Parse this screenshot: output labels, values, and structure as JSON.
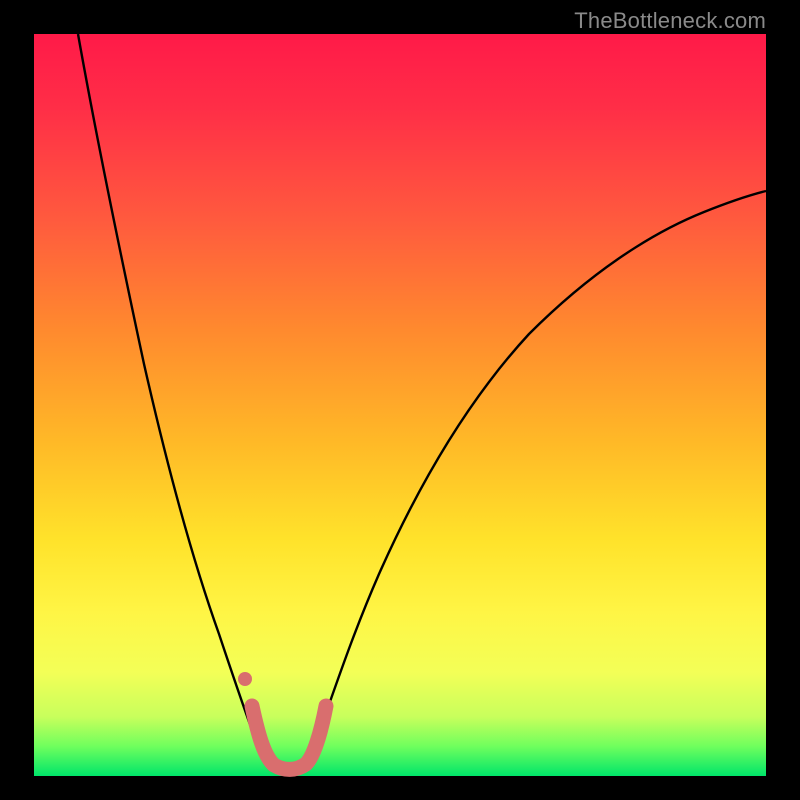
{
  "watermark": "TheBottleneck.com",
  "chart_data": {
    "type": "line",
    "title": "",
    "xlabel": "",
    "ylabel": "",
    "ylim": [
      0,
      100
    ],
    "series": [
      {
        "name": "black-curve-left",
        "x": [
          0.06,
          0.1,
          0.14,
          0.18,
          0.22,
          0.26,
          0.28,
          0.3,
          0.31
        ],
        "values": [
          100,
          88,
          73,
          55,
          36,
          16,
          9,
          4,
          3
        ]
      },
      {
        "name": "black-curve-right",
        "x": [
          0.37,
          0.4,
          0.44,
          0.5,
          0.56,
          0.64,
          0.72,
          0.8,
          0.88,
          0.96,
          1.0
        ],
        "values": [
          3,
          6,
          14,
          26,
          37,
          49,
          58,
          65,
          70,
          74,
          76
        ]
      },
      {
        "name": "pink-valley-highlight",
        "x": [
          0.295,
          0.31,
          0.33,
          0.35,
          0.37,
          0.385
        ],
        "values": [
          10,
          3,
          1,
          1,
          3,
          9
        ]
      },
      {
        "name": "pink-dot",
        "x": [
          0.285
        ],
        "values": [
          14
        ]
      }
    ]
  },
  "colors": {
    "black": "#000000",
    "pink": "#d96e6e"
  }
}
